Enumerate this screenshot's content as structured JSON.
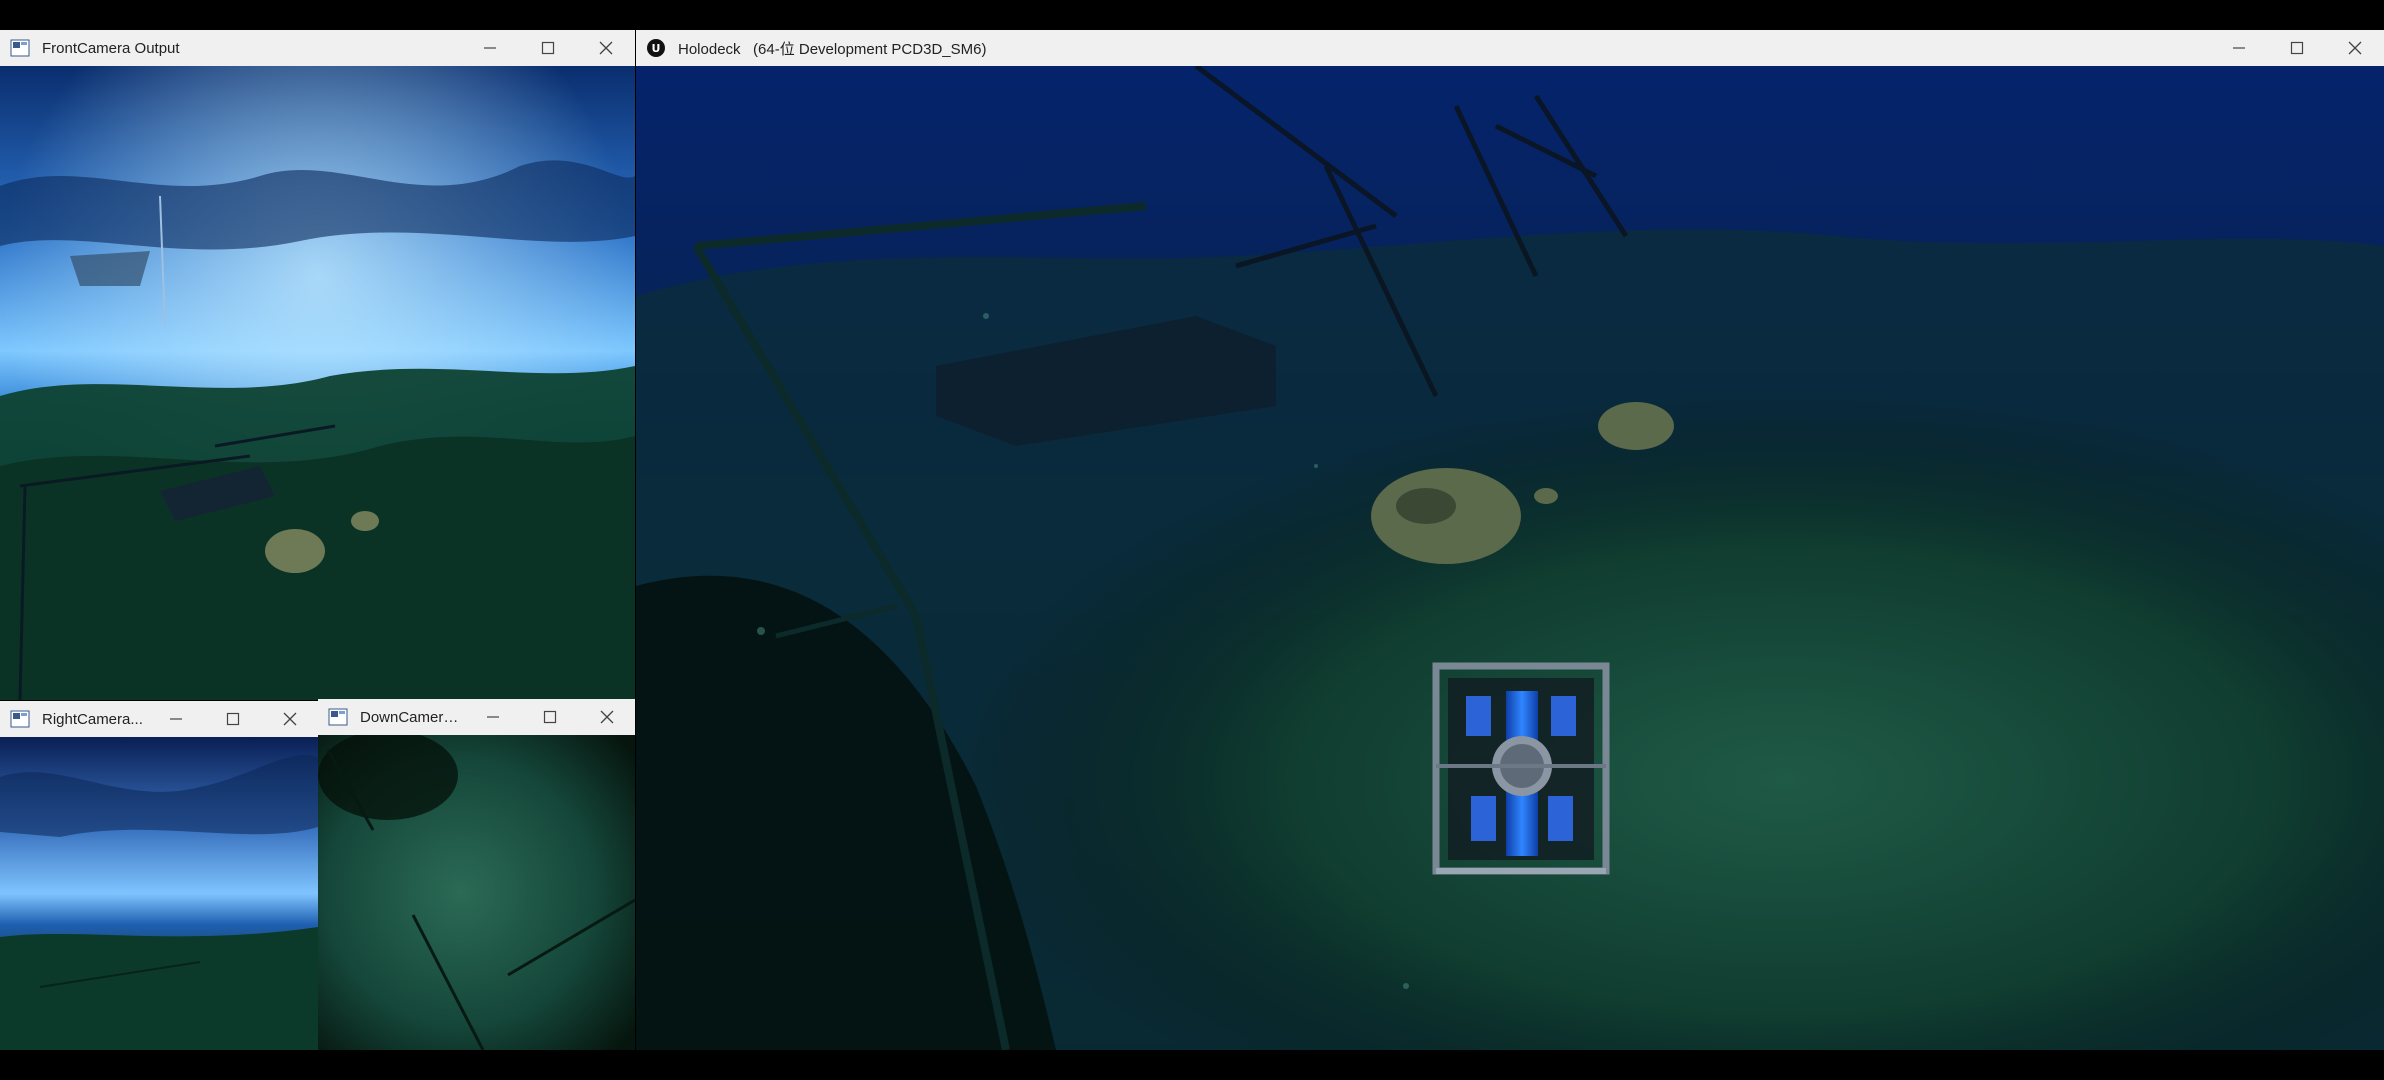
{
  "windows": {
    "front": {
      "title": "FrontCamera Output"
    },
    "right": {
      "title": "RightCamera..."
    },
    "down": {
      "title": "DownCamera..."
    },
    "holodeck": {
      "title": "Holodeck   (64-位 Development PCD3D_SM6)"
    }
  },
  "colors": {
    "titlebar_bg": "#f0f0f0",
    "water_deep": "#021a4a",
    "sea_floor": "#0f3b2c",
    "rov_blue": "#1f6ee8"
  }
}
